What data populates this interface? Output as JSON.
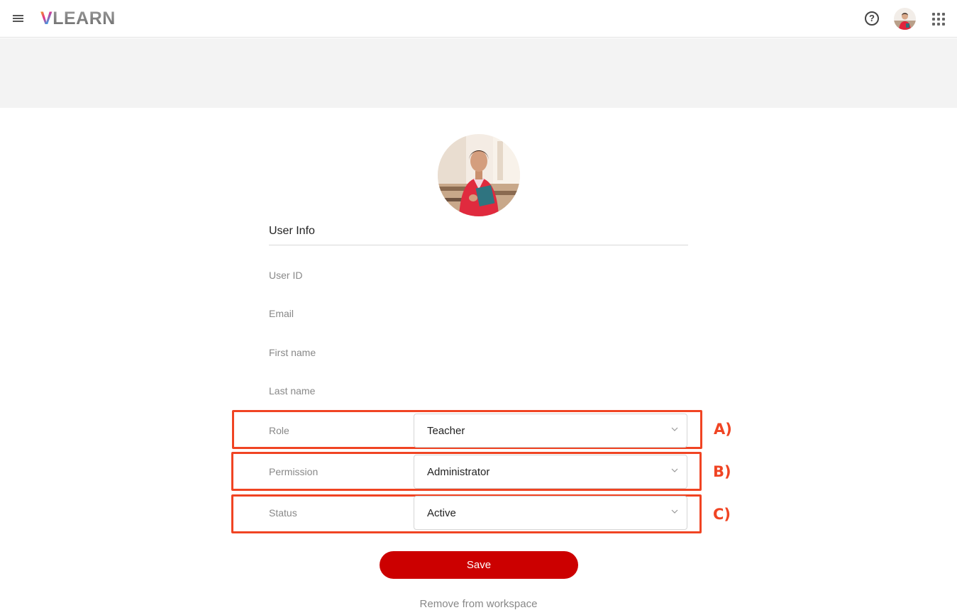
{
  "header": {
    "logo_v": "V",
    "logo_rest": "LEARN",
    "help_glyph": "?",
    "icons": [
      "menu-icon",
      "help-icon",
      "user-avatar",
      "apps-grid-icon"
    ]
  },
  "form": {
    "section_title": "User Info",
    "fields": {
      "user_id": "User ID",
      "email": "Email",
      "first_name": "First name",
      "last_name": "Last name",
      "role_label": "Role",
      "role_value": "Teacher",
      "permission_label": "Permission",
      "permission_value": "Administrator",
      "status_label": "Status",
      "status_value": "Active"
    },
    "save_label": "Save",
    "remove_label": "Remove from workspace"
  },
  "annotations": {
    "a": "A)",
    "b": "B)",
    "c": "C)"
  },
  "colors": {
    "primary": "#cc0000",
    "annotation": "#f04423",
    "banner": "#f3f3f3"
  }
}
